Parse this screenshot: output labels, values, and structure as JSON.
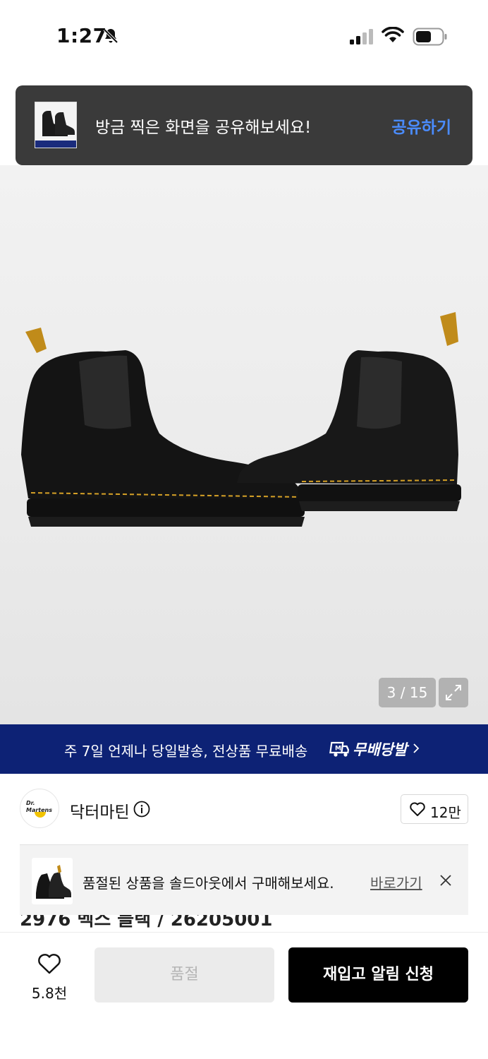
{
  "status_bar": {
    "time": "1:27",
    "icons": [
      "bell-slash-icon",
      "cellular-signal-icon",
      "wifi-icon",
      "battery-icon"
    ]
  },
  "share_toast": {
    "message": "방금 찍은 화면을 공유해보세요!",
    "action": "공유하기",
    "action_color": "#4a8cff"
  },
  "gallery": {
    "counter": "3 / 15",
    "expand_icon": "expand-icon"
  },
  "promo": {
    "text": "주 7일 언제나 당일발송, 전상품 무료배송",
    "logo": "무배당발",
    "background": "#0d2275"
  },
  "brand": {
    "name": "닥터마틴",
    "logo_text": "Dr. Martens",
    "likes": "12만"
  },
  "notice": {
    "text": "품절된 상품을 솔드아웃에서 구매해보세요.",
    "link": "바로가기"
  },
  "product": {
    "title_partial": "2976 벡스 블랙 / 26205001"
  },
  "action_bar": {
    "wish_count": "5.8천",
    "soldout_label": "품절",
    "restock_label": "재입고 알림 신청"
  }
}
